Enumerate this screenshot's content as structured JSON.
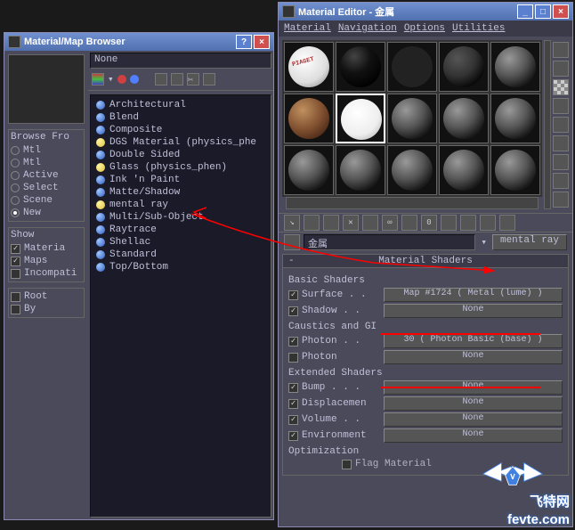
{
  "browser": {
    "title": "Material/Map Browser",
    "search_value": "None",
    "browse_from": {
      "label": "Browse Fro",
      "options": [
        "Mtl",
        "Mtl",
        "Active",
        "Select",
        "Scene",
        "New"
      ],
      "selected": 5
    },
    "show": {
      "label": "Show",
      "items": [
        {
          "label": "Materia",
          "checked": true
        },
        {
          "label": "Maps",
          "checked": true
        },
        {
          "label": "Incompati",
          "checked": false
        }
      ]
    },
    "filter": {
      "items": [
        {
          "label": "Root",
          "checked": false
        },
        {
          "label": "By",
          "checked": false
        }
      ]
    },
    "materials": [
      {
        "label": "Architectural",
        "color": "blue"
      },
      {
        "label": "Blend",
        "color": "blue"
      },
      {
        "label": "Composite",
        "color": "blue"
      },
      {
        "label": "DGS Material (physics_phe",
        "color": "yellow"
      },
      {
        "label": "Double Sided",
        "color": "blue"
      },
      {
        "label": "Glass (physics_phen)",
        "color": "yellow"
      },
      {
        "label": "Ink 'n Paint",
        "color": "blue"
      },
      {
        "label": "Matte/Shadow",
        "color": "blue"
      },
      {
        "label": "mental ray",
        "color": "yellow"
      },
      {
        "label": "Multi/Sub-Object",
        "color": "blue"
      },
      {
        "label": "Raytrace",
        "color": "blue"
      },
      {
        "label": "Shellac",
        "color": "blue"
      },
      {
        "label": "Standard",
        "color": "blue"
      },
      {
        "label": "Top/Bottom",
        "color": "blue"
      }
    ]
  },
  "editor": {
    "title": "Material Editor - 金属",
    "menu": [
      "Material",
      "Navigation",
      "Options",
      "Utilities"
    ],
    "spinner_value": "0",
    "material_name": "金属",
    "material_type": "mental ray",
    "rollout_title": "Material Shaders",
    "sections": {
      "basic": {
        "label": "Basic Shaders",
        "rows": [
          {
            "checked": true,
            "label": "Surface . .",
            "map": "Map #1724  ( Metal (lume) )"
          },
          {
            "checked": true,
            "label": "Shadow . .",
            "map": "None"
          }
        ]
      },
      "caustics": {
        "label": "Caustics and GI",
        "rows": [
          {
            "checked": true,
            "label": "Photon . .",
            "map": "30  ( Photon Basic (base) )"
          },
          {
            "checked": false,
            "label": "Photon",
            "map": "None"
          }
        ]
      },
      "extended": {
        "label": "Extended Shaders",
        "rows": [
          {
            "checked": true,
            "label": "Bump . . .",
            "map": "None"
          },
          {
            "checked": true,
            "label": "Displacemen",
            "map": "None"
          },
          {
            "checked": true,
            "label": "Volume . .",
            "map": "None"
          },
          {
            "checked": true,
            "label": "Environment",
            "map": "None"
          }
        ]
      },
      "optimization": {
        "label": "Optimization",
        "flag": {
          "checked": false,
          "label": "Flag Material"
        }
      }
    }
  },
  "watermark": "fevte.com",
  "watermark_cn": "飞特网"
}
